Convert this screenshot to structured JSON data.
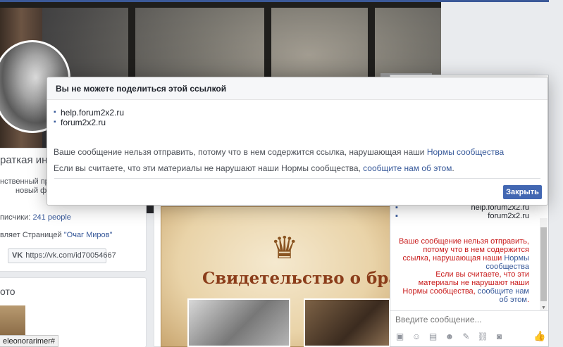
{
  "profile": {
    "intro_title": "раткая инфо",
    "intro_line1": "нственный про",
    "intro_line2": "новый фо",
    "subscribers_label": "писчики: ",
    "subscribers_value": "241 people",
    "manages_label": "вляет Страницей ",
    "manages_value": "\"Очаг Миров\"",
    "vk_icon": "vk-icon",
    "vk_link": "https://vk.com/id70054667",
    "photos_title": "ото",
    "status_url": "eleonorarimer#"
  },
  "post": {
    "certificate_title": "Свидетельство о браке",
    "crown_icon": "crown-icon"
  },
  "chat": {
    "links": [
      "help.forum2x2.ru",
      "forum2x2.ru"
    ],
    "error_part1": "Ваше сообщение нельзя отправить, потому что в нем содержится ссылка, нарушающая наши ",
    "error_link1": "Нормы сообщества",
    "error_part2": "Если вы считаете, что эти материалы не нарушают наши Нормы сообщества, ",
    "error_link2": "сообщите нам об этом",
    "error_end": ".",
    "input_placeholder": "Введите сообщение...",
    "tools": [
      "photo-icon",
      "sticker-icon",
      "gif-icon",
      "emoji-icon",
      "attach-icon",
      "link-icon",
      "camera-icon"
    ],
    "like_icon": "thumbs-up-icon"
  },
  "dialog": {
    "title": "Вы не можете поделиться этой ссылкой",
    "links": [
      "help.forum2x2.ru",
      "forum2x2.ru"
    ],
    "message1": "Ваше сообщение нельзя отправить, потому что в нем содержится ссылка, нарушающая наши ",
    "message1_link": "Нормы сообщества",
    "message2": "Если вы считаете, что эти материалы не нарушают наши Нормы сообщества, ",
    "message2_link": "сообщите нам об этом",
    "message2_end": ".",
    "close_button": "Закрыть"
  },
  "colors": {
    "accent": "#4267b2",
    "link": "#365899",
    "error": "#c81a1a"
  }
}
